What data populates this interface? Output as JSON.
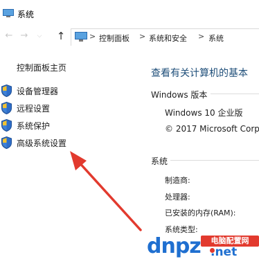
{
  "window": {
    "title": "系统"
  },
  "address": {
    "crumbs": [
      "控制面板",
      "系统和安全",
      "系统"
    ],
    "separator": ">"
  },
  "sidebar": {
    "home": "控制面板主页",
    "items": [
      {
        "label": "设备管理器",
        "icon": "shield-icon"
      },
      {
        "label": "远程设置",
        "icon": "shield-icon"
      },
      {
        "label": "系统保护",
        "icon": "shield-icon"
      },
      {
        "label": "高级系统设置",
        "icon": "shield-icon"
      }
    ]
  },
  "main": {
    "heading": "查看有关计算机的基本",
    "windows_edition": {
      "label": "Windows 版本",
      "name": "Windows 10 企业版",
      "copyright": "© 2017 Microsoft Corp"
    },
    "system": {
      "label": "系统",
      "rows": [
        "制造商:",
        "处理器:",
        "已安装的内存(RAM):",
        "系统类型:"
      ]
    }
  },
  "watermark": {
    "text": "dnpz",
    "tld": ".net",
    "badge": "电脑配置网"
  },
  "colors": {
    "heading": "#1e4e79",
    "arrow": "#e23a2e",
    "watermark_blue": "#1f6fd0"
  }
}
